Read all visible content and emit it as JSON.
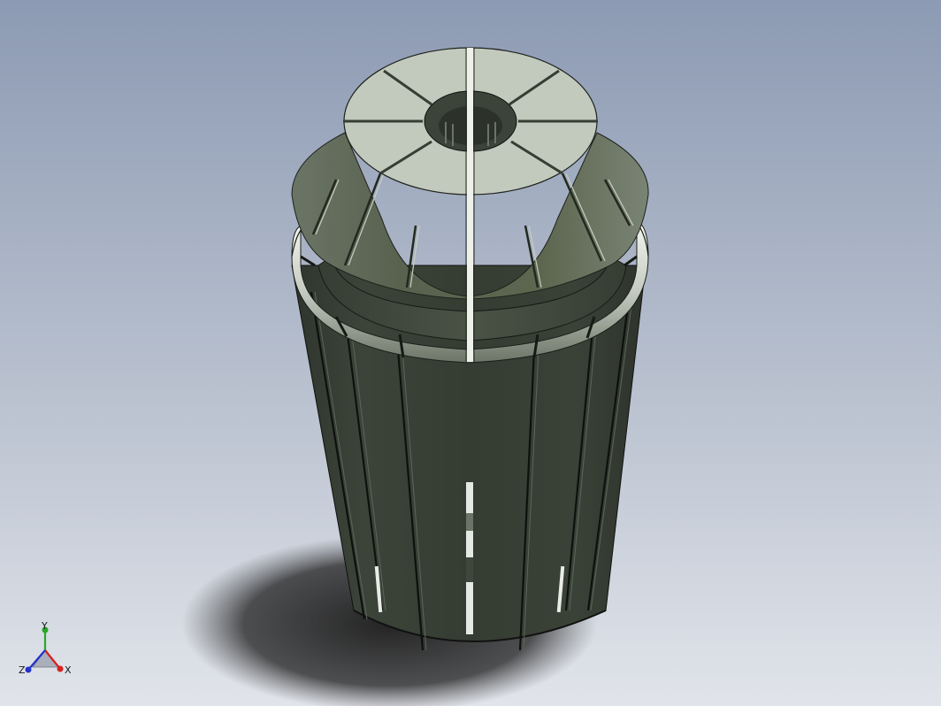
{
  "viewport": {
    "background_top": "#8d9bb4",
    "background_bottom": "#dfe2e8"
  },
  "model": {
    "name_icon": "er-collet-icon",
    "body_color": "#3c4439",
    "face_color": "#c2c9bd",
    "slot_color": "#eef1ea"
  },
  "triad": {
    "x_label": "X",
    "y_label": "Y",
    "z_label": "Z",
    "x_color": "#d42020",
    "y_color": "#26a826",
    "z_color": "#2233cc"
  }
}
